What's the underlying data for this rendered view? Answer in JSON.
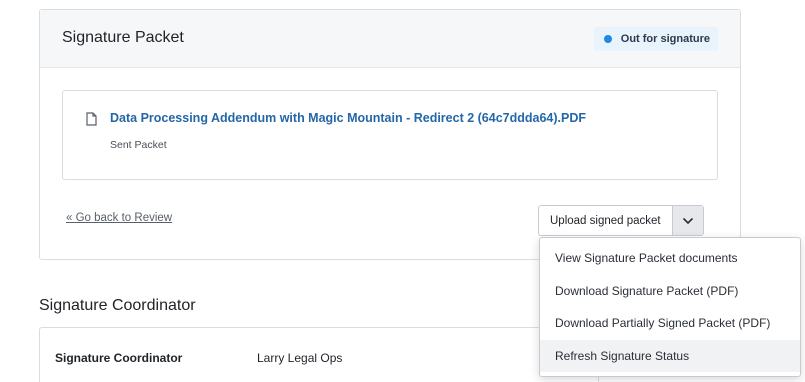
{
  "packet": {
    "title": "Signature Packet",
    "status": "Out for signature",
    "document": {
      "name": "Data Processing Addendum with Magic Mountain - Redirect 2 (64c7ddda64).PDF",
      "subtitle": "Sent Packet",
      "icon": "file-icon"
    },
    "back_link": "« Go back to Review",
    "upload_button": "Upload signed packet"
  },
  "menu": {
    "items": [
      "View Signature Packet documents",
      "Download Signature Packet (PDF)",
      "Download Partially Signed Packet (PDF)",
      "Refresh Signature Status"
    ]
  },
  "coordinator": {
    "section_title": "Signature Coordinator",
    "label": "Signature Coordinator",
    "value": "Larry Legal Ops"
  },
  "colors": {
    "link": "#2467a8",
    "status_dot": "#1a8ae5",
    "status_bg": "#e9f3fc"
  }
}
